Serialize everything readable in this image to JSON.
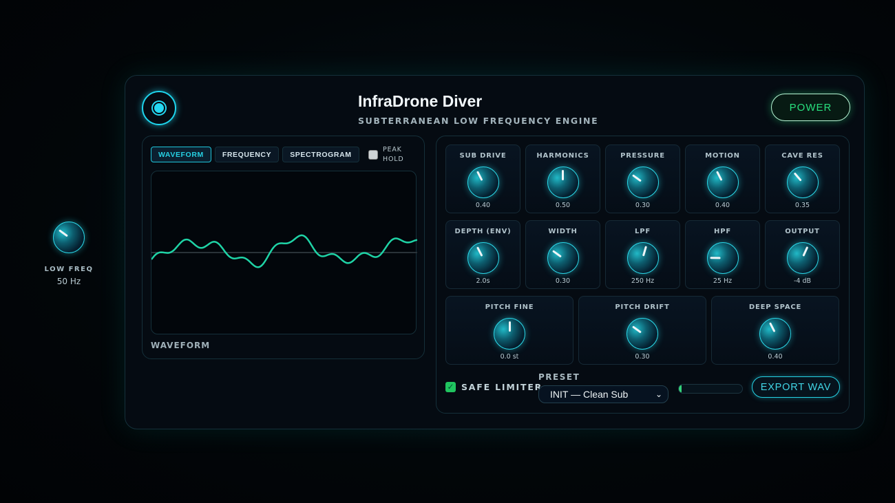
{
  "app": {
    "title": "InfraDrone Diver",
    "subtitle": "SUBTERRANEAN LOW FREQUENCY ENGINE",
    "power_label": "POWER"
  },
  "side_knob": {
    "label": "LOW FREQ",
    "value": "50 Hz",
    "level": 0.3
  },
  "viz": {
    "tabs": [
      {
        "label": "WAVEFORM",
        "active": true
      },
      {
        "label": "FREQUENCY"
      },
      {
        "label": "SPECTROGRAM"
      }
    ],
    "peak_hold_label": "PEAK HOLD",
    "peak_hold_checked": false,
    "view_label": "WAVEFORM",
    "waveform_color": "#1fd3a6"
  },
  "knobs_row1": [
    {
      "label": "SUB DRIVE",
      "value": "0.40",
      "level": 0.4
    },
    {
      "label": "HARMONICS",
      "value": "0.50",
      "level": 0.5
    },
    {
      "label": "PRESSURE",
      "value": "0.30",
      "level": 0.3
    },
    {
      "label": "MOTION",
      "value": "0.40",
      "level": 0.4
    },
    {
      "label": "CAVE RES",
      "value": "0.35",
      "level": 0.35
    }
  ],
  "knobs_row2": [
    {
      "label": "DEPTH (ENV)",
      "value": "2.0s",
      "level": 0.4
    },
    {
      "label": "WIDTH",
      "value": "0.30",
      "level": 0.3
    },
    {
      "label": "LPF",
      "value": "250 Hz",
      "level": 0.56
    },
    {
      "label": "HPF",
      "value": "25 Hz",
      "level": 0.17
    },
    {
      "label": "OUTPUT",
      "value": "-4 dB",
      "level": 0.59
    }
  ],
  "knobs_row3": [
    {
      "label": "PITCH FINE",
      "value": "0.0 st",
      "level": 0.5
    },
    {
      "label": "PITCH DRIFT",
      "value": "0.30",
      "level": 0.3
    },
    {
      "label": "DEEP SPACE",
      "value": "0.40",
      "level": 0.4
    }
  ],
  "footer": {
    "safe_limiter_label": "SAFE LIMITER",
    "safe_limiter_checked": true,
    "preset_label": "PRESET",
    "preset_value": "INIT — Clean Sub",
    "meter_level": 0.04,
    "export_label": "EXPORT WAV"
  }
}
